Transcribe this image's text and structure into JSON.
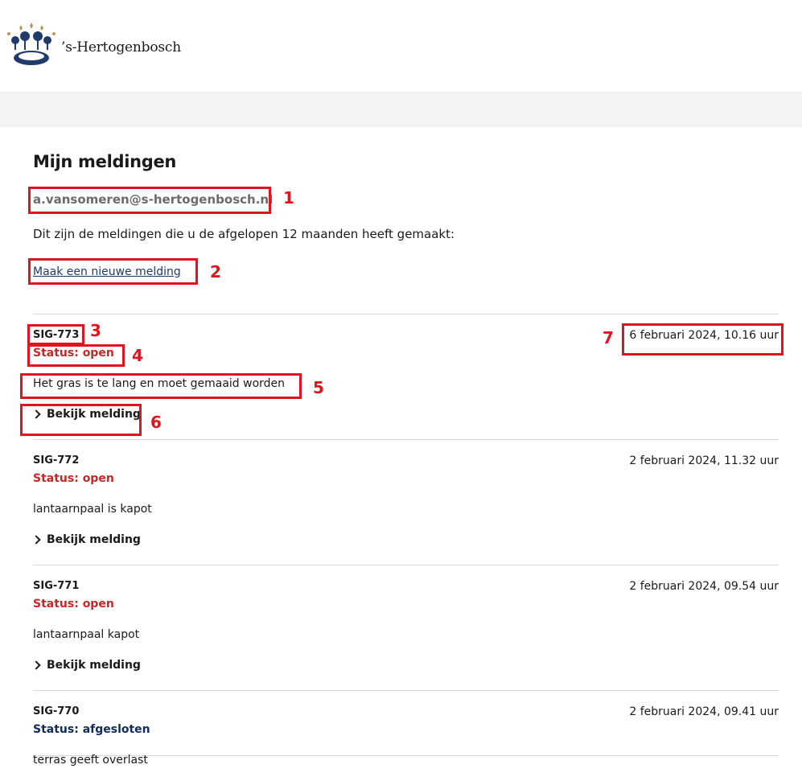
{
  "header": {
    "brand": "’s-Hertogenbosch",
    "logo_icon": "crown-logo-icon"
  },
  "page": {
    "title": "Mijn meldingen",
    "email": "a.vansomeren@s-hertogenbosch.nl",
    "intro": "Dit zijn de meldingen die u de afgelopen 12 maanden heeft gemaakt:",
    "new_link": "Maak een nieuwe melding"
  },
  "items": [
    {
      "id": "SIG-773",
      "date": "6 februari 2024, 10.16 uur",
      "status": "Status: open",
      "description": "Het gras is te lang en moet gemaaid worden",
      "view": "Bekijk melding"
    },
    {
      "id": "SIG-772",
      "date": "2 februari 2024, 11.32 uur",
      "status": "Status: open",
      "description": "lantaarnpaal is kapot",
      "view": "Bekijk melding"
    },
    {
      "id": "SIG-771",
      "date": "2 februari 2024, 09.54 uur",
      "status": "Status: open",
      "description": "lantaarnpaal kapot",
      "view": "Bekijk melding"
    },
    {
      "id": "SIG-770",
      "date": "2 februari 2024, 09.41 uur",
      "status": "Status: afgesloten",
      "description": "terras geeft overlast"
    }
  ],
  "annotations": [
    "1",
    "2",
    "3",
    "4",
    "5",
    "6",
    "7"
  ],
  "colors": {
    "status_open": "#c62828",
    "status_closed": "#0f2a5e",
    "annotation": "#e0141e",
    "link": "#1f3a6b"
  }
}
